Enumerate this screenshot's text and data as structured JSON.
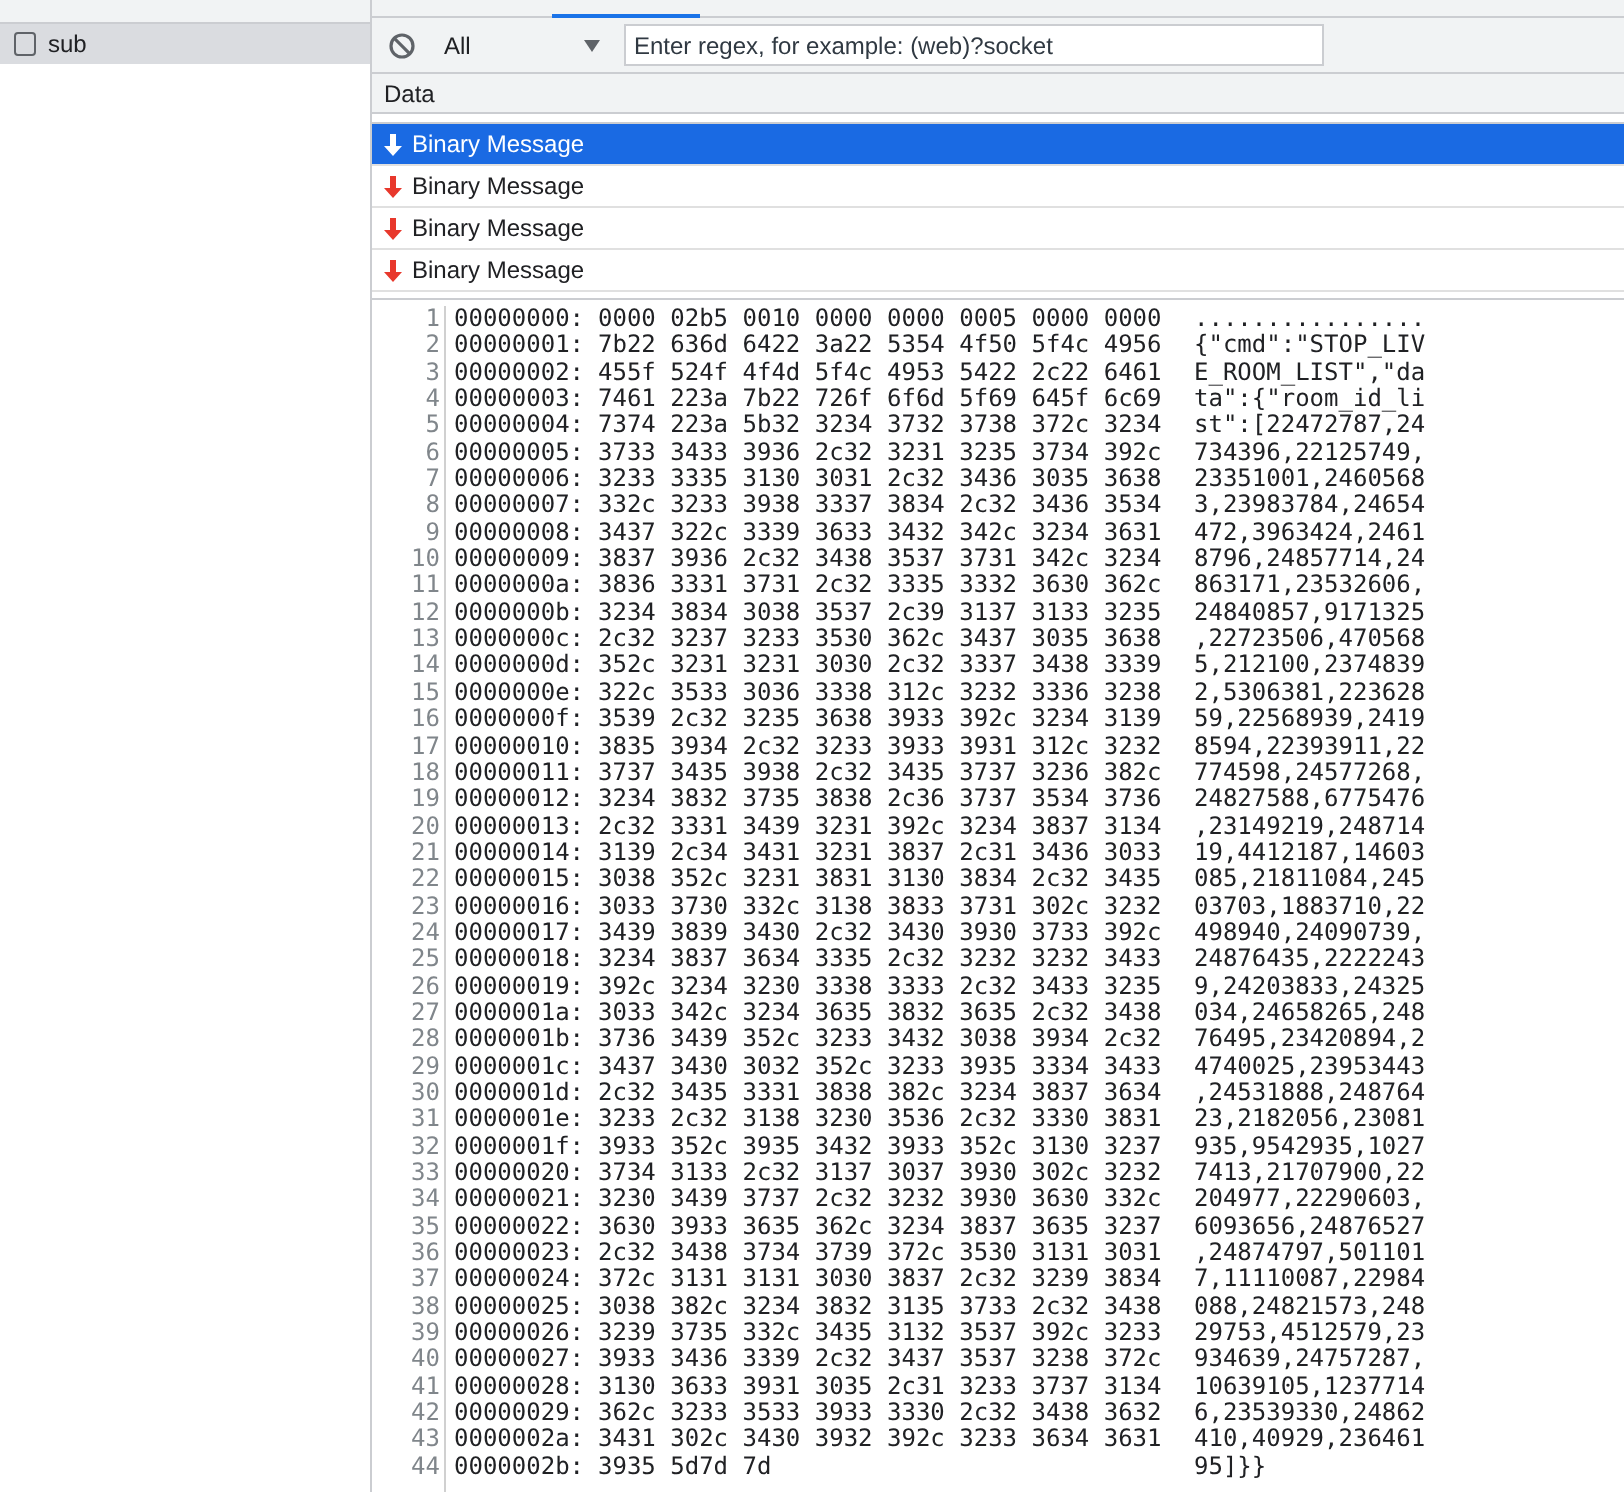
{
  "sidebar": {
    "items": [
      {
        "label": "sub",
        "selected": true
      }
    ]
  },
  "toolbar": {
    "filter": "All",
    "search": {
      "placeholder": "Enter regex, for example: (web)?socket"
    }
  },
  "messages": {
    "column": "Data",
    "rows": [
      {
        "label": "Binary Message",
        "selected": true
      },
      {
        "label": "Binary Message",
        "selected": false
      },
      {
        "label": "Binary Message",
        "selected": false
      },
      {
        "label": "Binary Message",
        "selected": false
      }
    ]
  },
  "hex_view": {
    "lines": [
      {
        "line": "1",
        "offset": "00000000:",
        "hex": "0000 02b5 0010 0000 0000 0005 0000 0000",
        "ascii": "................"
      },
      {
        "line": "2",
        "offset": "00000001:",
        "hex": "7b22 636d 6422 3a22 5354 4f50 5f4c 4956",
        "ascii": "{\"cmd\":\"STOP_LIV"
      },
      {
        "line": "3",
        "offset": "00000002:",
        "hex": "455f 524f 4f4d 5f4c 4953 5422 2c22 6461",
        "ascii": "E_ROOM_LIST\",\"da"
      },
      {
        "line": "4",
        "offset": "00000003:",
        "hex": "7461 223a 7b22 726f 6f6d 5f69 645f 6c69",
        "ascii": "ta\":{\"room_id_li"
      },
      {
        "line": "5",
        "offset": "00000004:",
        "hex": "7374 223a 5b32 3234 3732 3738 372c 3234",
        "ascii": "st\":[22472787,24"
      },
      {
        "line": "6",
        "offset": "00000005:",
        "hex": "3733 3433 3936 2c32 3231 3235 3734 392c",
        "ascii": "734396,22125749,"
      },
      {
        "line": "7",
        "offset": "00000006:",
        "hex": "3233 3335 3130 3031 2c32 3436 3035 3638",
        "ascii": "23351001,2460568"
      },
      {
        "line": "8",
        "offset": "00000007:",
        "hex": "332c 3233 3938 3337 3834 2c32 3436 3534",
        "ascii": "3,23983784,24654"
      },
      {
        "line": "9",
        "offset": "00000008:",
        "hex": "3437 322c 3339 3633 3432 342c 3234 3631",
        "ascii": "472,3963424,2461"
      },
      {
        "line": "10",
        "offset": "00000009:",
        "hex": "3837 3936 2c32 3438 3537 3731 342c 3234",
        "ascii": "8796,24857714,24"
      },
      {
        "line": "11",
        "offset": "0000000a:",
        "hex": "3836 3331 3731 2c32 3335 3332 3630 362c",
        "ascii": "863171,23532606,"
      },
      {
        "line": "12",
        "offset": "0000000b:",
        "hex": "3234 3834 3038 3537 2c39 3137 3133 3235",
        "ascii": "24840857,9171325"
      },
      {
        "line": "13",
        "offset": "0000000c:",
        "hex": "2c32 3237 3233 3530 362c 3437 3035 3638",
        "ascii": ",22723506,470568"
      },
      {
        "line": "14",
        "offset": "0000000d:",
        "hex": "352c 3231 3231 3030 2c32 3337 3438 3339",
        "ascii": "5,212100,2374839"
      },
      {
        "line": "15",
        "offset": "0000000e:",
        "hex": "322c 3533 3036 3338 312c 3232 3336 3238",
        "ascii": "2,5306381,223628"
      },
      {
        "line": "16",
        "offset": "0000000f:",
        "hex": "3539 2c32 3235 3638 3933 392c 3234 3139",
        "ascii": "59,22568939,2419"
      },
      {
        "line": "17",
        "offset": "00000010:",
        "hex": "3835 3934 2c32 3233 3933 3931 312c 3232",
        "ascii": "8594,22393911,22"
      },
      {
        "line": "18",
        "offset": "00000011:",
        "hex": "3737 3435 3938 2c32 3435 3737 3236 382c",
        "ascii": "774598,24577268,"
      },
      {
        "line": "19",
        "offset": "00000012:",
        "hex": "3234 3832 3735 3838 2c36 3737 3534 3736",
        "ascii": "24827588,6775476"
      },
      {
        "line": "20",
        "offset": "00000013:",
        "hex": "2c32 3331 3439 3231 392c 3234 3837 3134",
        "ascii": ",23149219,248714"
      },
      {
        "line": "21",
        "offset": "00000014:",
        "hex": "3139 2c34 3431 3231 3837 2c31 3436 3033",
        "ascii": "19,4412187,14603"
      },
      {
        "line": "22",
        "offset": "00000015:",
        "hex": "3038 352c 3231 3831 3130 3834 2c32 3435",
        "ascii": "085,21811084,245"
      },
      {
        "line": "23",
        "offset": "00000016:",
        "hex": "3033 3730 332c 3138 3833 3731 302c 3232",
        "ascii": "03703,1883710,22"
      },
      {
        "line": "24",
        "offset": "00000017:",
        "hex": "3439 3839 3430 2c32 3430 3930 3733 392c",
        "ascii": "498940,24090739,"
      },
      {
        "line": "25",
        "offset": "00000018:",
        "hex": "3234 3837 3634 3335 2c32 3232 3232 3433",
        "ascii": "24876435,2222243"
      },
      {
        "line": "26",
        "offset": "00000019:",
        "hex": "392c 3234 3230 3338 3333 2c32 3433 3235",
        "ascii": "9,24203833,24325"
      },
      {
        "line": "27",
        "offset": "0000001a:",
        "hex": "3033 342c 3234 3635 3832 3635 2c32 3438",
        "ascii": "034,24658265,248"
      },
      {
        "line": "28",
        "offset": "0000001b:",
        "hex": "3736 3439 352c 3233 3432 3038 3934 2c32",
        "ascii": "76495,23420894,2"
      },
      {
        "line": "29",
        "offset": "0000001c:",
        "hex": "3437 3430 3032 352c 3233 3935 3334 3433",
        "ascii": "4740025,23953443"
      },
      {
        "line": "30",
        "offset": "0000001d:",
        "hex": "2c32 3435 3331 3838 382c 3234 3837 3634",
        "ascii": ",24531888,248764"
      },
      {
        "line": "31",
        "offset": "0000001e:",
        "hex": "3233 2c32 3138 3230 3536 2c32 3330 3831",
        "ascii": "23,2182056,23081"
      },
      {
        "line": "32",
        "offset": "0000001f:",
        "hex": "3933 352c 3935 3432 3933 352c 3130 3237",
        "ascii": "935,9542935,1027"
      },
      {
        "line": "33",
        "offset": "00000020:",
        "hex": "3734 3133 2c32 3137 3037 3930 302c 3232",
        "ascii": "7413,21707900,22"
      },
      {
        "line": "34",
        "offset": "00000021:",
        "hex": "3230 3439 3737 2c32 3232 3930 3630 332c",
        "ascii": "204977,22290603,"
      },
      {
        "line": "35",
        "offset": "00000022:",
        "hex": "3630 3933 3635 362c 3234 3837 3635 3237",
        "ascii": "6093656,24876527"
      },
      {
        "line": "36",
        "offset": "00000023:",
        "hex": "2c32 3438 3734 3739 372c 3530 3131 3031",
        "ascii": ",24874797,501101"
      },
      {
        "line": "37",
        "offset": "00000024:",
        "hex": "372c 3131 3131 3030 3837 2c32 3239 3834",
        "ascii": "7,11110087,22984"
      },
      {
        "line": "38",
        "offset": "00000025:",
        "hex": "3038 382c 3234 3832 3135 3733 2c32 3438",
        "ascii": "088,24821573,248"
      },
      {
        "line": "39",
        "offset": "00000026:",
        "hex": "3239 3735 332c 3435 3132 3537 392c 3233",
        "ascii": "29753,4512579,23"
      },
      {
        "line": "40",
        "offset": "00000027:",
        "hex": "3933 3436 3339 2c32 3437 3537 3238 372c",
        "ascii": "934639,24757287,"
      },
      {
        "line": "41",
        "offset": "00000028:",
        "hex": "3130 3633 3931 3035 2c31 3233 3737 3134",
        "ascii": "10639105,1237714"
      },
      {
        "line": "42",
        "offset": "00000029:",
        "hex": "362c 3233 3533 3933 3330 2c32 3438 3632",
        "ascii": "6,23539330,24862"
      },
      {
        "line": "43",
        "offset": "0000002a:",
        "hex": "3431 302c 3430 3932 392c 3233 3634 3631",
        "ascii": "410,40929,236461"
      },
      {
        "line": "44",
        "offset": "0000002b:",
        "hex": "3935 5d7d 7d",
        "ascii": "95]}}"
      }
    ]
  }
}
